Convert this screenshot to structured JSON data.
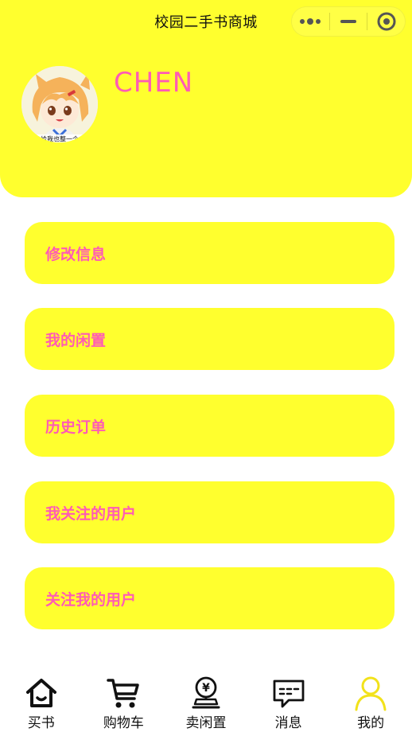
{
  "nav": {
    "title": "校园二手书商城"
  },
  "profile": {
    "username": "CHEN",
    "avatar_caption": "给我也整一个"
  },
  "menu": [
    {
      "label": "修改信息"
    },
    {
      "label": "我的闲置"
    },
    {
      "label": "历史订单"
    },
    {
      "label": "我关注的用户"
    },
    {
      "label": "关注我的用户"
    }
  ],
  "tabbar": [
    {
      "label": "买书",
      "icon": "home-icon"
    },
    {
      "label": "购物车",
      "icon": "cart-icon"
    },
    {
      "label": "卖闲置",
      "icon": "yen-coin-icon"
    },
    {
      "label": "消息",
      "icon": "chat-icon"
    },
    {
      "label": "我的",
      "icon": "user-icon",
      "active": true
    }
  ],
  "colors": {
    "accent_yellow": "#ffff2e",
    "accent_pink": "#ff5bb4",
    "active_tab": "#f2e21a"
  }
}
